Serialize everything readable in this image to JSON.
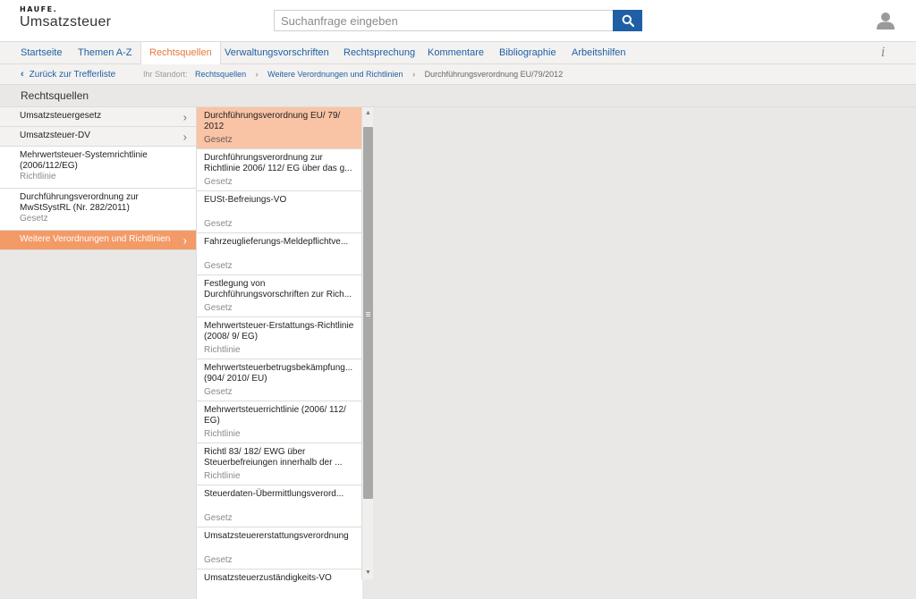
{
  "header": {
    "logo_text": "HAUFE.",
    "app_title": "Umsatzsteuer",
    "search_placeholder": "Suchanfrage eingeben",
    "search_icon": "search-icon",
    "user_icon": "user-icon"
  },
  "nav": {
    "items": [
      {
        "label": "Startseite"
      },
      {
        "label": "Themen A-Z"
      },
      {
        "label": "Rechtsquellen"
      },
      {
        "label": "Verwaltungsvorschriften"
      },
      {
        "label": "Rechtsprechung"
      },
      {
        "label": "Kommentare"
      },
      {
        "label": "Bibliographie"
      },
      {
        "label": "Arbeitshilfen"
      }
    ],
    "active_index": 2,
    "info_label": "i"
  },
  "breadcrumb": {
    "back_label": "Zurück zur Trefferliste",
    "location_label": "Ihr Standort:",
    "items": [
      {
        "label": "Rechtsquellen"
      },
      {
        "label": "Weitere Verordnungen und Richtlinien"
      },
      {
        "label": "Durchführungsverordnung EU/79/2012"
      }
    ]
  },
  "section_title": "Rechtsquellen",
  "left_panel": {
    "items": [
      {
        "title": "Umsatzsteuergesetz",
        "sub": ""
      },
      {
        "title": "Umsatzsteuer-DV",
        "sub": ""
      },
      {
        "title": "Mehrwertsteuer-Systemrichtlinie (2006/112/EG)",
        "sub": "Richtlinie"
      },
      {
        "title": "Durchführungsverordnung zur MwStSystRL (Nr. 282/2011)",
        "sub": "Gesetz"
      },
      {
        "title": "Weitere Verordnungen und Richtlinien",
        "sub": ""
      }
    ]
  },
  "middle_panel": {
    "items": [
      {
        "title": "Durchführungsverordnung EU/ 79/ 2012",
        "type": "Gesetz"
      },
      {
        "title": "Durchführungsverordnung zur Richtlinie 2006/ 112/ EG über das g...",
        "type": "Gesetz"
      },
      {
        "title": "EUSt-Befreiungs-VO",
        "type": "Gesetz"
      },
      {
        "title": "Fahrzeuglieferungs-Meldepflichtve...",
        "type": "Gesetz"
      },
      {
        "title": "Festlegung von Durchführungsvorschriften zur Rich...",
        "type": "Gesetz"
      },
      {
        "title": "Mehrwertsteuer-Erstattungs-Richtlinie (2008/ 9/ EG)",
        "type": "Richtlinie"
      },
      {
        "title": "Mehrwertsteuerbetrugsbekämpfung... (904/ 2010/ EU)",
        "type": "Gesetz"
      },
      {
        "title": "Mehrwertsteuerrichtlinie (2006/ 112/ EG)",
        "type": "Richtlinie"
      },
      {
        "title": "Richtl 83/ 182/ EWG über Steuerbefreiungen innerhalb der ...",
        "type": "Richtlinie"
      },
      {
        "title": "Steuerdaten-Übermittlungsverord...",
        "type": "Gesetz"
      },
      {
        "title": "Umsatzsteuererstattungsverordnung",
        "type": "Gesetz"
      },
      {
        "title": "Umsatzsteuerzuständigkeits-VO",
        "type": ""
      }
    ]
  },
  "colors": {
    "accent_orange": "#f39a67",
    "active_item_bg": "#f9c3a5",
    "link_blue": "#1f5fa6",
    "nav_active": "#e8773a"
  }
}
